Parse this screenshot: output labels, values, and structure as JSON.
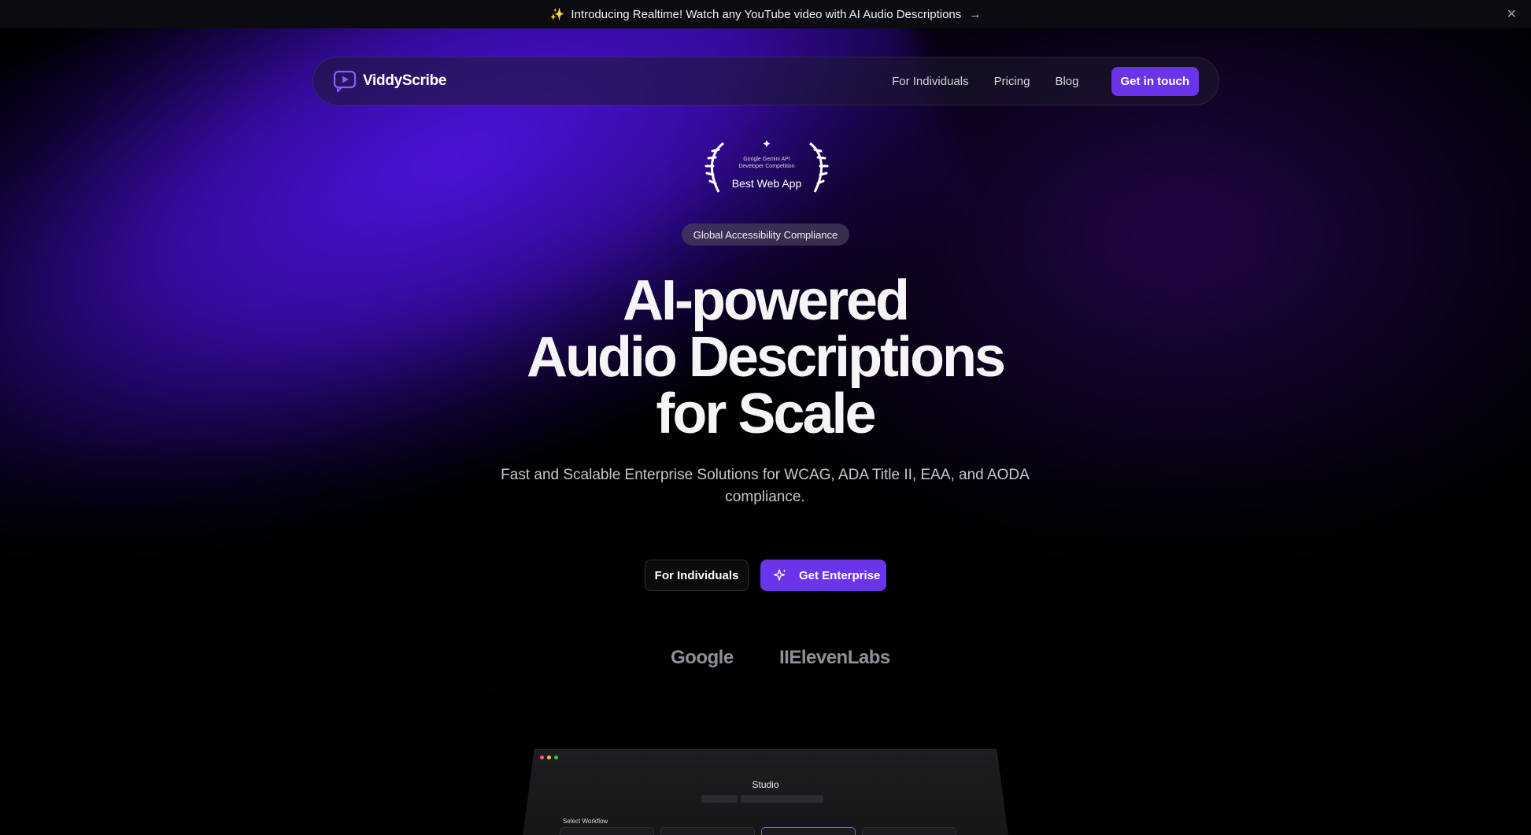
{
  "announcement": {
    "text": "Introducing Realtime! Watch any YouTube video with AI Audio Descriptions",
    "sparkle_icon": "sparkles-icon",
    "arrow": "→",
    "close": "✕"
  },
  "nav": {
    "brand": "ViddyScribe",
    "links": [
      "For Individuals",
      "Pricing",
      "Blog"
    ],
    "cta": "Get in touch"
  },
  "award": {
    "line1": "Google Gemini API",
    "line2": "Developer Competition",
    "title": "Best Web App"
  },
  "hero": {
    "pill": "Global Accessibility Compliance",
    "headline": [
      "AI-powered",
      "Audio Descriptions",
      "for Scale"
    ],
    "subtitle": "Fast and Scalable Enterprise Solutions for WCAG, ADA Title II, EAA, and AODA compliance.",
    "btn_individuals": "For Individuals",
    "btn_enterprise": "Get Enterprise"
  },
  "partners": [
    "Google",
    "IIElevenLabs"
  ],
  "preview": {
    "title": "Studio",
    "workflow_label": "Select Workflow",
    "window_dots": [
      "#ff5f57",
      "#febc2e",
      "#28c840"
    ]
  },
  "colors": {
    "accent": "#6a35e8",
    "background": "#000000"
  }
}
